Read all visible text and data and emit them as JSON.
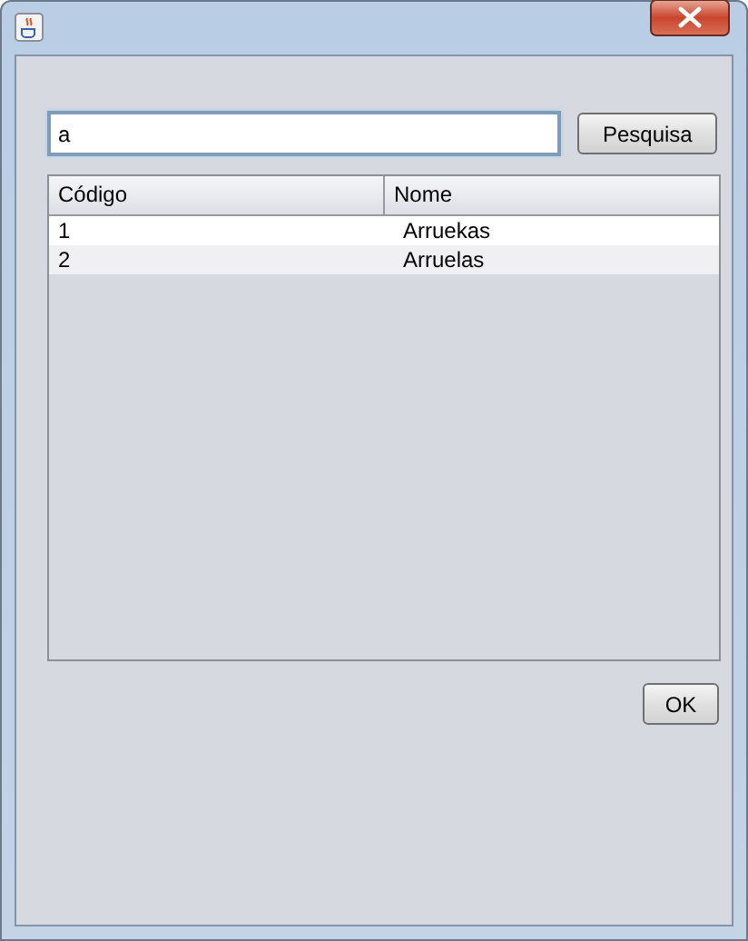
{
  "search": {
    "value": "a"
  },
  "search_button": "Pesquisa",
  "table": {
    "columns": [
      "Código",
      "Nome"
    ],
    "rows": [
      {
        "cells": [
          "1",
          "Arruekas"
        ],
        "selected": false
      },
      {
        "cells": [
          "2",
          "Arruelas"
        ],
        "selected": false
      }
    ]
  },
  "ok_button": "OK"
}
